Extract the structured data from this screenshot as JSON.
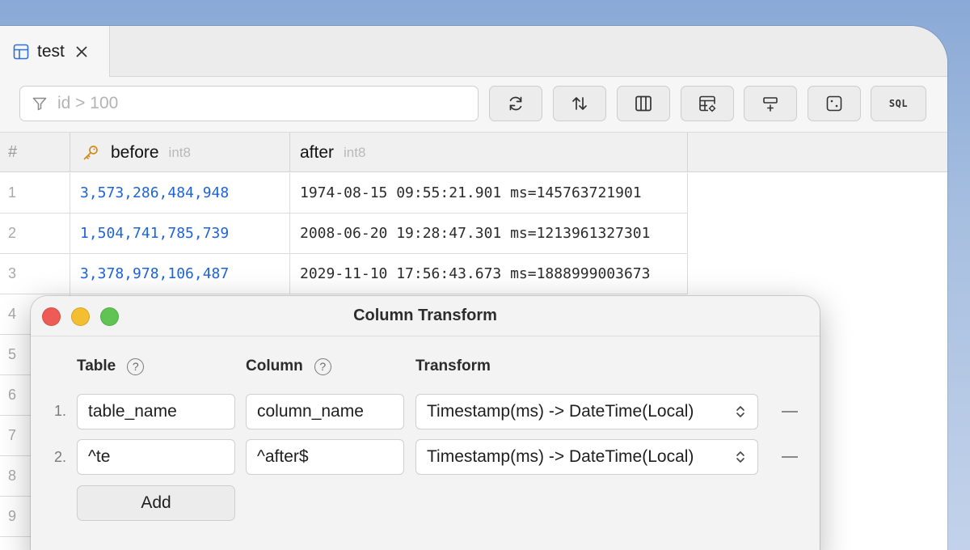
{
  "tab": {
    "label": "test",
    "icon": "table-icon"
  },
  "toolbar": {
    "filter_placeholder": "id > 100",
    "buttons": [
      "refresh-icon",
      "sort-icon",
      "columns-icon",
      "table-settings-icon",
      "insert-row-icon",
      "random-icon"
    ],
    "sql_label": "SQL"
  },
  "grid": {
    "columns": [
      {
        "name": "#",
        "type": ""
      },
      {
        "name": "before",
        "type": "int8",
        "key": true
      },
      {
        "name": "after",
        "type": "int8"
      }
    ],
    "rows": [
      {
        "num": "1",
        "before": "3,573,286,484,948",
        "after": "1974-08-15 09:55:21.901 ms=145763721901"
      },
      {
        "num": "2",
        "before": "1,504,741,785,739",
        "after": "2008-06-20 19:28:47.301 ms=1213961327301"
      },
      {
        "num": "3",
        "before": "3,378,978,106,487",
        "after": "2029-11-10 17:56:43.673 ms=1888999003673"
      }
    ],
    "extra_row_numbers": [
      "4",
      "5",
      "6",
      "7",
      "8",
      "9"
    ]
  },
  "dialog": {
    "title": "Column Transform",
    "headers": {
      "table": "Table",
      "column": "Column",
      "transform": "Transform"
    },
    "help_glyph": "?",
    "rows": [
      {
        "index": "1.",
        "table": "table_name",
        "column": "column_name",
        "transform": "Timestamp(ms) -> DateTime(Local)"
      },
      {
        "index": "2.",
        "table": "^te",
        "column": "^after$",
        "transform": "Timestamp(ms) -> DateTime(Local)"
      }
    ],
    "add_label": "Add"
  },
  "colors": {
    "accent": "#1f63d6",
    "close": "#ee5b56",
    "minimize": "#f3be2f",
    "maximize": "#5fc453"
  }
}
